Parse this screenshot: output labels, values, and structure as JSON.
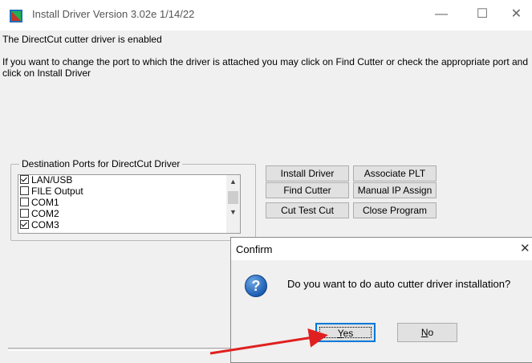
{
  "window": {
    "title": "Install Driver Version 3.02e 1/14/22",
    "controls": {
      "minimize": "—",
      "maximize": "☐",
      "close": "✕"
    }
  },
  "status": {
    "line1": "The DirectCut cutter driver is enabled",
    "line2": "If you want to change the port to which the driver is attached you may click on Find Cutter or check the appropriate port and click on Install Driver"
  },
  "ports": {
    "group_label": "Destination Ports for DirectCut Driver",
    "items": [
      {
        "label": "LAN/USB",
        "checked": true
      },
      {
        "label": "FILE Output",
        "checked": false
      },
      {
        "label": "COM1",
        "checked": false
      },
      {
        "label": "COM2",
        "checked": false
      },
      {
        "label": "COM3",
        "checked": true
      }
    ]
  },
  "buttons": {
    "install_driver": "Install Driver",
    "associate_plt": "Associate PLT",
    "find_cutter": "Find Cutter",
    "manual_ip": "Manual IP Assign",
    "cut_test": "Cut Test Cut",
    "close_program": "Close Program"
  },
  "dialog": {
    "title": "Confirm",
    "message": "Do you want to do auto cutter driver installation?",
    "yes_rest": "es",
    "yes_mnemonic": "Y",
    "no_rest": "o",
    "no_mnemonic": "N",
    "close": "✕",
    "icon": "question-icon"
  },
  "annotation": {
    "color": "#e02020"
  }
}
